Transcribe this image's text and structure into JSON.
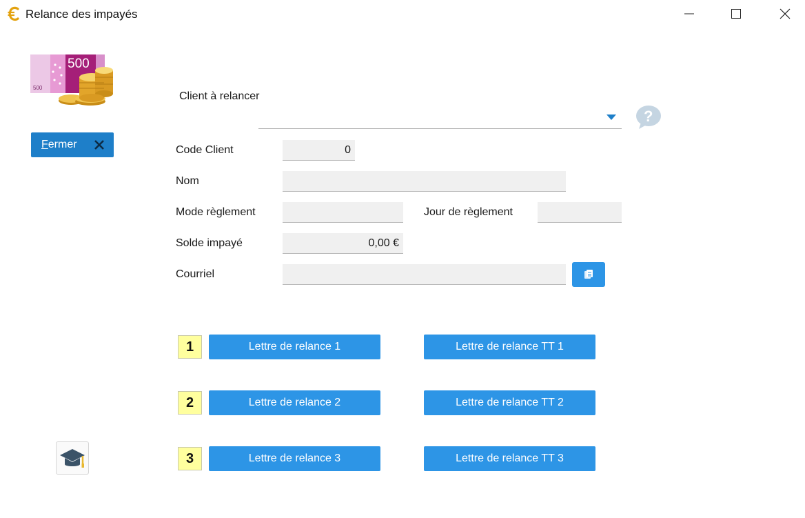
{
  "window": {
    "title": "Relance des impayés"
  },
  "toolbar": {
    "close_label_first": "F",
    "close_label_rest": "ermer"
  },
  "form": {
    "client_label": "Client à relancer",
    "client_value": "",
    "code_client_label": "Code Client",
    "code_client_value": "0",
    "nom_label": "Nom",
    "nom_value": "",
    "mode_reglement_label": "Mode règlement",
    "mode_reglement_value": "",
    "jour_reglement_label": "Jour de règlement",
    "jour_reglement_value": "",
    "solde_label": "Solde impayé",
    "solde_value": "0,00 €",
    "courriel_label": "Courriel",
    "courriel_value": ""
  },
  "relances": [
    {
      "number": "1",
      "letter_label": "Lettre de relance 1",
      "tt_label": "Lettre de relance TT 1"
    },
    {
      "number": "2",
      "letter_label": "Lettre de relance 2",
      "tt_label": "Lettre de relance TT 2"
    },
    {
      "number": "3",
      "letter_label": "Lettre de relance 3",
      "tt_label": "Lettre de relance TT 3"
    }
  ],
  "illustration": {
    "banknote_text": "500",
    "banknote_small_text": "500"
  },
  "colors": {
    "accent": "#1e7fc9",
    "button": "#2d95e6",
    "badge": "#ffff9e"
  },
  "icons": {
    "app": "euro-icon",
    "minimize": "minimize-icon",
    "maximize": "maximize-icon",
    "close": "close-icon",
    "help": "help-icon",
    "courriel_button": "copy-icon",
    "hat": "graduation-cap-icon"
  }
}
